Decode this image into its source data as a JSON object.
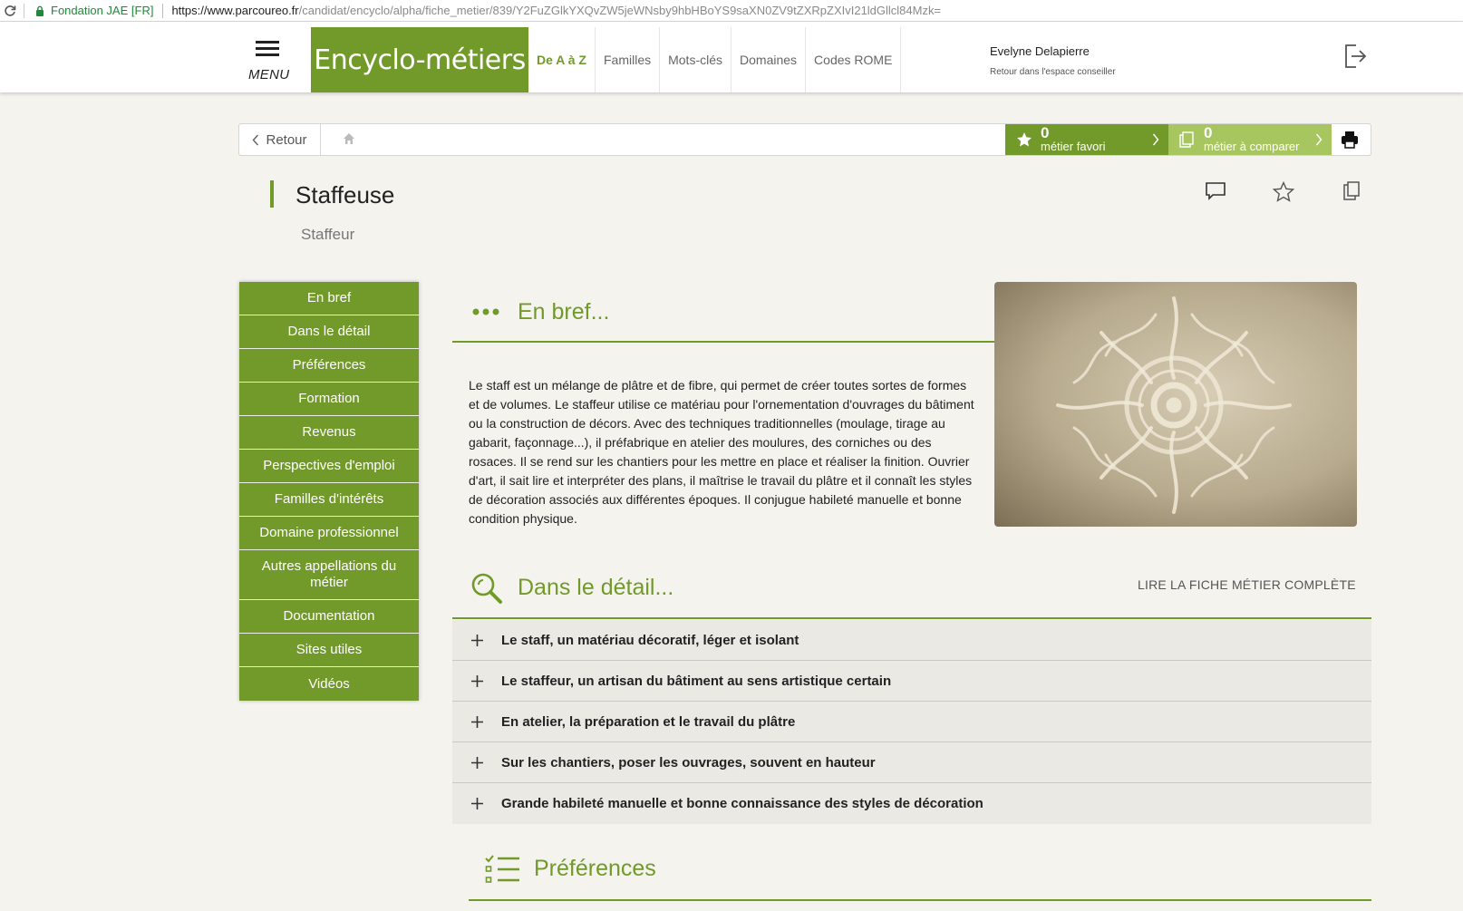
{
  "browser": {
    "site_identity": "Fondation JAE [FR]",
    "url_host": "https://www.parcoureo.fr",
    "url_path": "/candidat/encyclo/alpha/fiche_metier/839/Y2FuZGlkYXQvZW5jeWNsby9hbHBoYS9saXN0ZV9tZXRpZXIvI21ldGllcl84Mzk="
  },
  "nav": {
    "menu_label": "MENU",
    "brand": "Encyclo-métiers",
    "tabs": [
      "De A à Z",
      "Familles",
      "Mots-clés",
      "Domaines",
      "Codes ROME"
    ],
    "active_tab": 0,
    "user_name": "Evelyne Delapierre",
    "user_back": "Retour dans l'espace conseiller"
  },
  "toolbar": {
    "back_label": "Retour",
    "favorites_count": "0",
    "favorites_label": "métier favori",
    "compare_count": "0",
    "compare_label": "métier à comparer"
  },
  "page": {
    "title": "Staffeuse",
    "subtitle": "Staffeur"
  },
  "sidemenu": {
    "items": [
      "En bref",
      "Dans le détail",
      "Préférences",
      "Formation",
      "Revenus",
      "Perspectives d'emploi",
      "Familles d'intérêts",
      "Domaine professionnel",
      "Autres appellations du métier",
      "Documentation",
      "Sites utiles",
      "Vidéos"
    ]
  },
  "sections": {
    "bref_title": "En bref...",
    "bref_text": "Le staff est un mélange de plâtre et de fibre, qui permet de créer toutes sortes de formes et de volumes. Le staffeur utilise ce matériau pour l'ornementation d'ouvrages du bâtiment ou la construction de décors. Avec des techniques traditionnelles (moulage, tirage au gabarit, façonnage...), il préfabrique en atelier des moulures, des corniches ou des rosaces. Il se rend sur les chantiers pour les mettre en place et réaliser la finition. Ouvrier d'art, il sait lire et interpréter des plans, il maîtrise le travail du plâtre et il connaît les styles de décoration associés aux différentes époques. Il conjugue habileté manuelle et bonne condition physique.",
    "detail_title": "Dans le détail...",
    "read_full": "LIRE LA FICHE MÉTIER COMPLÈTE",
    "detail_items": [
      "Le staff, un matériau décoratif, léger et isolant",
      "Le staffeur, un artisan du bâtiment au sens artistique certain",
      "En atelier, la préparation et le travail du plâtre",
      "Sur les chantiers, poser les ouvrages, souvent en hauteur",
      "Grande habileté manuelle et bonne connaissance des styles de décoration"
    ],
    "pref_title": "Préférences"
  },
  "colors": {
    "brand_green": "#729a2b",
    "light_green": "#a8c660",
    "background": "#f4f3ee"
  }
}
